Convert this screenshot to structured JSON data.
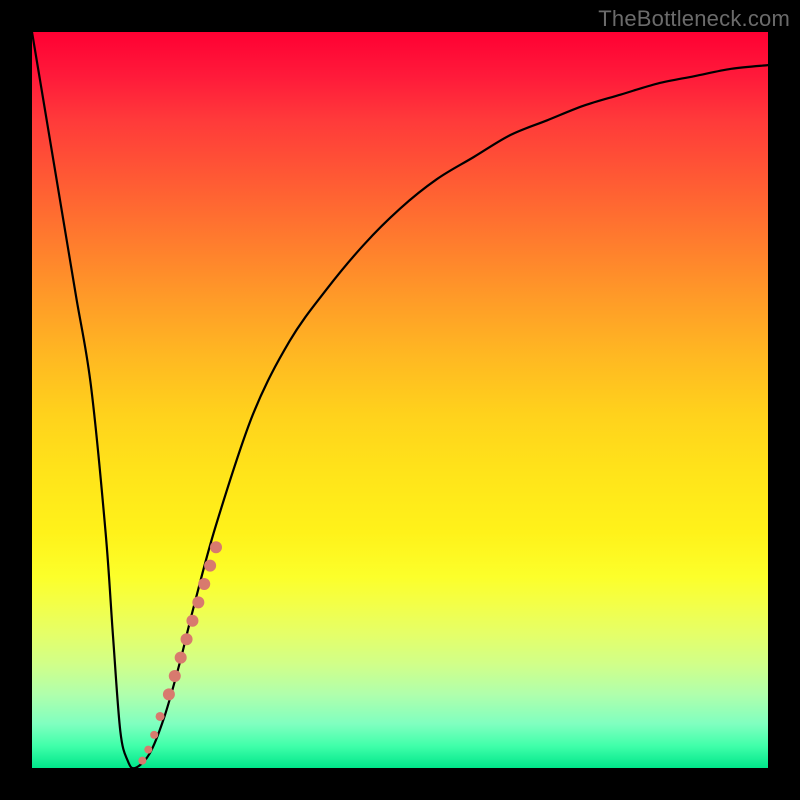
{
  "watermark": "TheBottleneck.com",
  "colors": {
    "curve_stroke": "#000000",
    "marker_fill": "#d87a6e",
    "frame_bg": "#000000"
  },
  "chart_data": {
    "type": "line",
    "title": "",
    "xlabel": "",
    "ylabel": "",
    "xlim": [
      0,
      100
    ],
    "ylim": [
      0,
      100
    ],
    "grid": false,
    "series": [
      {
        "name": "bottleneck-curve",
        "x": [
          0,
          2,
          4,
          6,
          8,
          10,
          11,
          12,
          13,
          14,
          16,
          18,
          20,
          22,
          25,
          30,
          35,
          40,
          45,
          50,
          55,
          60,
          65,
          70,
          75,
          80,
          85,
          90,
          95,
          100
        ],
        "y": [
          100,
          88,
          76,
          64,
          52,
          32,
          18,
          5,
          1,
          0,
          2,
          7,
          14,
          22,
          33,
          48,
          58,
          65,
          71,
          76,
          80,
          83,
          86,
          88,
          90,
          91.5,
          93,
          94,
          95,
          95.5
        ]
      }
    ],
    "markers": [
      {
        "x": 15.0,
        "y": 1.0,
        "r": 4
      },
      {
        "x": 15.8,
        "y": 2.5,
        "r": 4
      },
      {
        "x": 16.6,
        "y": 4.5,
        "r": 4
      },
      {
        "x": 17.4,
        "y": 7.0,
        "r": 4.5
      },
      {
        "x": 18.6,
        "y": 10.0,
        "r": 6
      },
      {
        "x": 19.4,
        "y": 12.5,
        "r": 6
      },
      {
        "x": 20.2,
        "y": 15.0,
        "r": 6
      },
      {
        "x": 21.0,
        "y": 17.5,
        "r": 6
      },
      {
        "x": 21.8,
        "y": 20.0,
        "r": 6
      },
      {
        "x": 22.6,
        "y": 22.5,
        "r": 6
      },
      {
        "x": 23.4,
        "y": 25.0,
        "r": 6
      },
      {
        "x": 24.2,
        "y": 27.5,
        "r": 6
      },
      {
        "x": 25.0,
        "y": 30.0,
        "r": 6
      }
    ]
  }
}
